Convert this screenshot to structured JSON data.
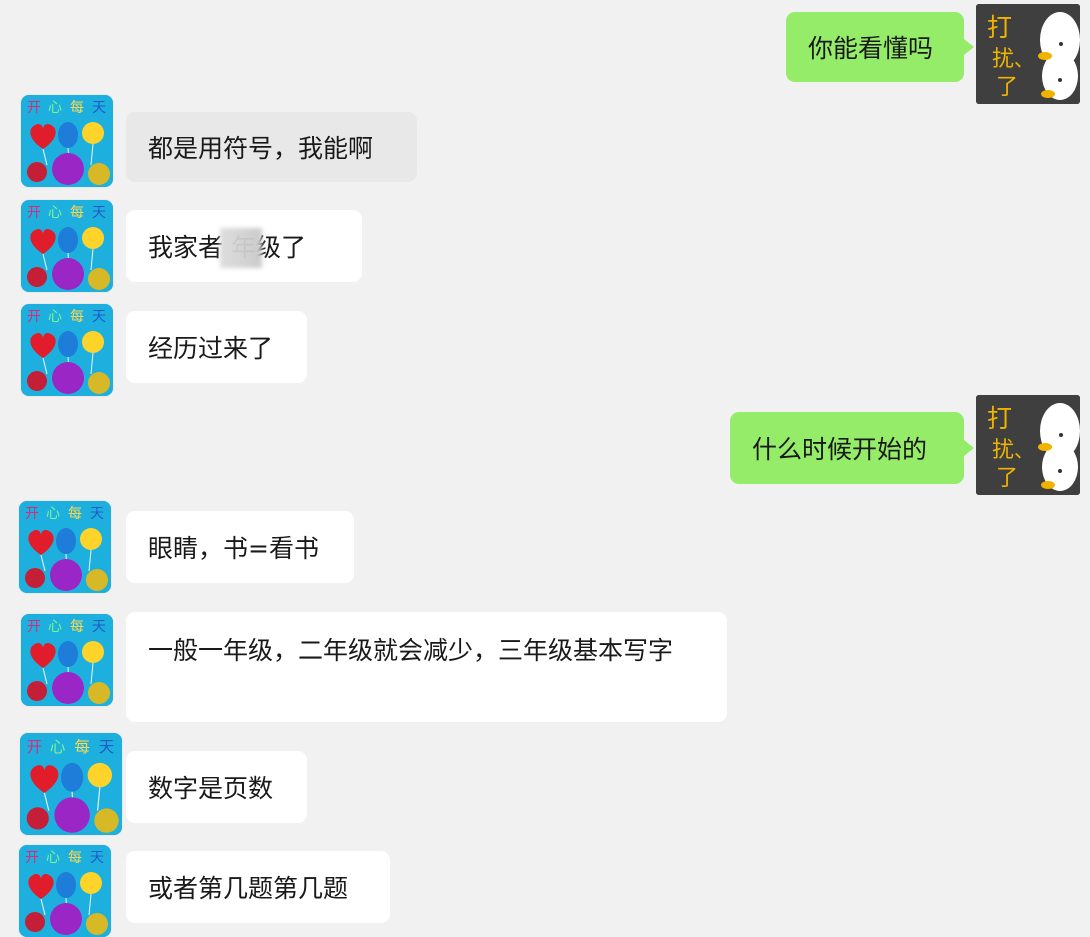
{
  "messages": [
    {
      "id": "m1",
      "side": "right",
      "text": "你能看懂吗"
    },
    {
      "id": "m2",
      "side": "left",
      "text": "都是用符号，我能啊"
    },
    {
      "id": "m3",
      "side": "left",
      "text": "我家者 年级了"
    },
    {
      "id": "m4",
      "side": "left",
      "text": "经历过来了"
    },
    {
      "id": "m5",
      "side": "right",
      "text": "什么时候开始的"
    },
    {
      "id": "m6",
      "side": "left",
      "text": "眼睛，书=看书"
    },
    {
      "id": "m7",
      "side": "left",
      "text": "一般一年级，二年级就会减少，三年级基本写字"
    },
    {
      "id": "m8",
      "side": "left",
      "text": "数字是页数"
    },
    {
      "id": "m9",
      "side": "left",
      "text": "或者第几题第几题"
    }
  ],
  "avatars": {
    "contact_text": [
      "开",
      "心",
      "每",
      "天"
    ],
    "self_text": [
      "打",
      "扰",
      "、",
      "了"
    ]
  },
  "colors": {
    "background": "#f1f1f1",
    "left_bubble": "#ffffff",
    "left_bubble_gray": "#e8e8e8",
    "right_bubble": "#95ec69",
    "text": "#191919"
  }
}
